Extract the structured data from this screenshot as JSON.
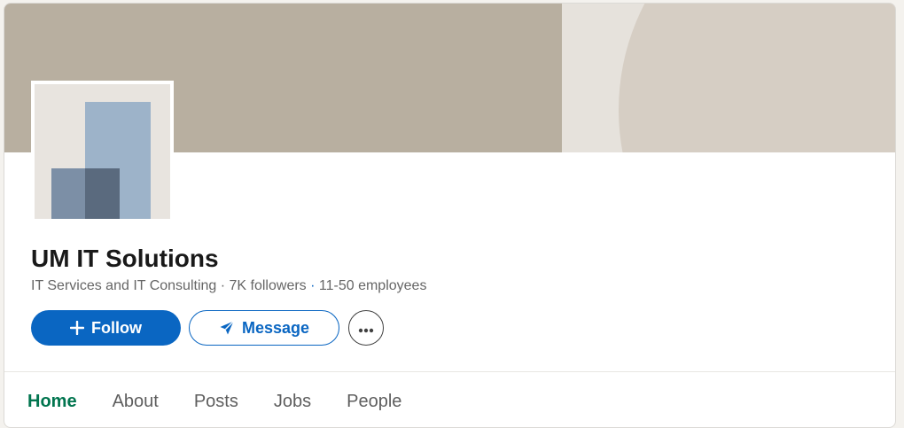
{
  "company": {
    "name": "UM IT Solutions",
    "industry": "IT Services and IT Consulting",
    "followers": "7K followers",
    "employees": "11-50 employees",
    "separator": " · "
  },
  "actions": {
    "follow_label": "Follow",
    "message_label": "Message",
    "more_label": "···"
  },
  "tabs": [
    {
      "label": "Home",
      "active": true
    },
    {
      "label": "About",
      "active": false
    },
    {
      "label": "Posts",
      "active": false
    },
    {
      "label": "Jobs",
      "active": false
    },
    {
      "label": "People",
      "active": false
    }
  ],
  "icons": {
    "follow": "plus-icon",
    "message": "send-icon",
    "more": "more-horizontal-icon"
  },
  "colors": {
    "accent": "#0a66c2",
    "active_tab": "#01754f",
    "cover": "#b8afa0"
  }
}
